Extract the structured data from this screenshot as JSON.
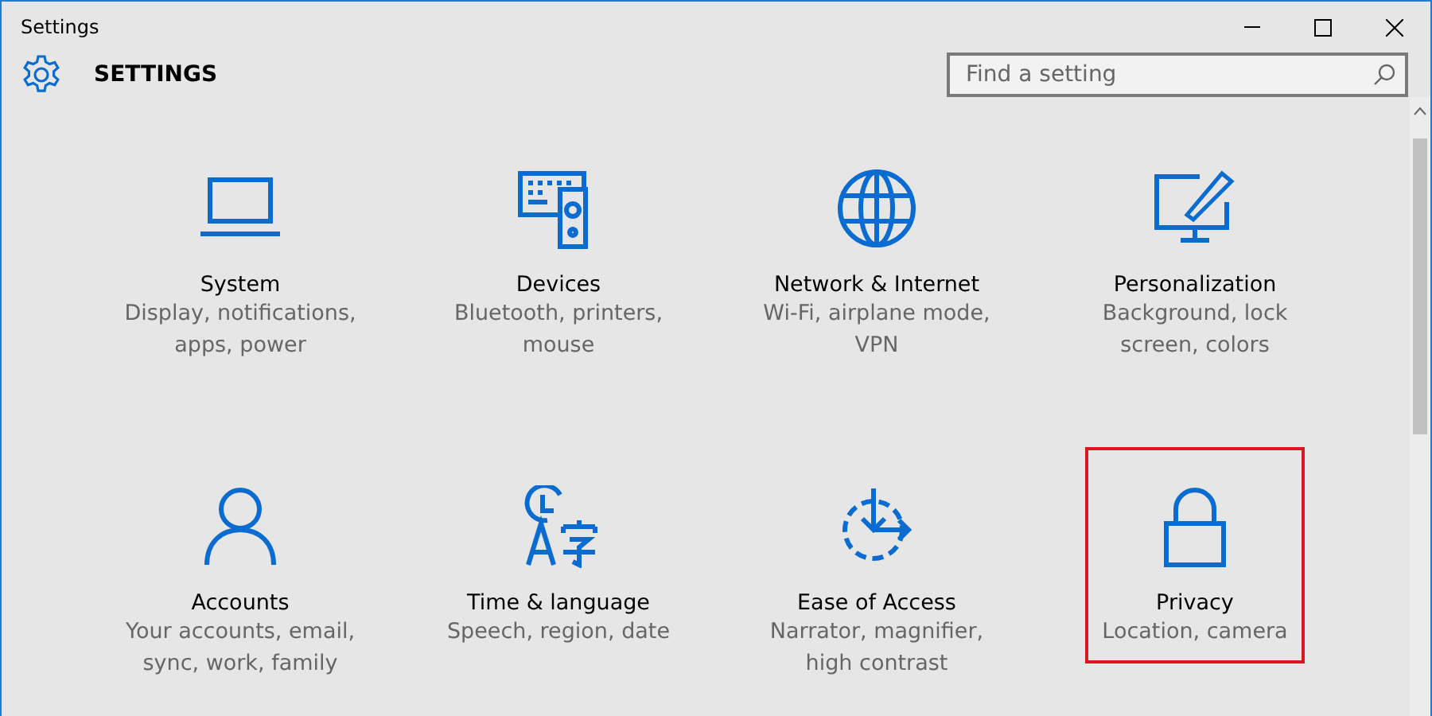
{
  "window": {
    "title": "Settings"
  },
  "header": {
    "title": "SETTINGS",
    "search": {
      "placeholder": "Find a setting"
    }
  },
  "categories": [
    {
      "kind": "system",
      "title": "System",
      "description": "Display, notifications, apps, power",
      "highlighted": false
    },
    {
      "kind": "devices",
      "title": "Devices",
      "description": "Bluetooth, printers, mouse",
      "highlighted": false
    },
    {
      "kind": "network",
      "title": "Network & Internet",
      "description": "Wi-Fi, airplane mode, VPN",
      "highlighted": false
    },
    {
      "kind": "personalization",
      "title": "Personalization",
      "description": "Background, lock screen, colors",
      "highlighted": false
    },
    {
      "kind": "accounts",
      "title": "Accounts",
      "description": "Your accounts, email, sync, work, family",
      "highlighted": false
    },
    {
      "kind": "time",
      "title": "Time & language",
      "description": "Speech, region, date",
      "highlighted": false
    },
    {
      "kind": "ease",
      "title": "Ease of Access",
      "description": "Narrator, magnifier, high contrast",
      "highlighted": false
    },
    {
      "kind": "privacy",
      "title": "Privacy",
      "description": "Location, camera",
      "highlighted": true
    }
  ]
}
